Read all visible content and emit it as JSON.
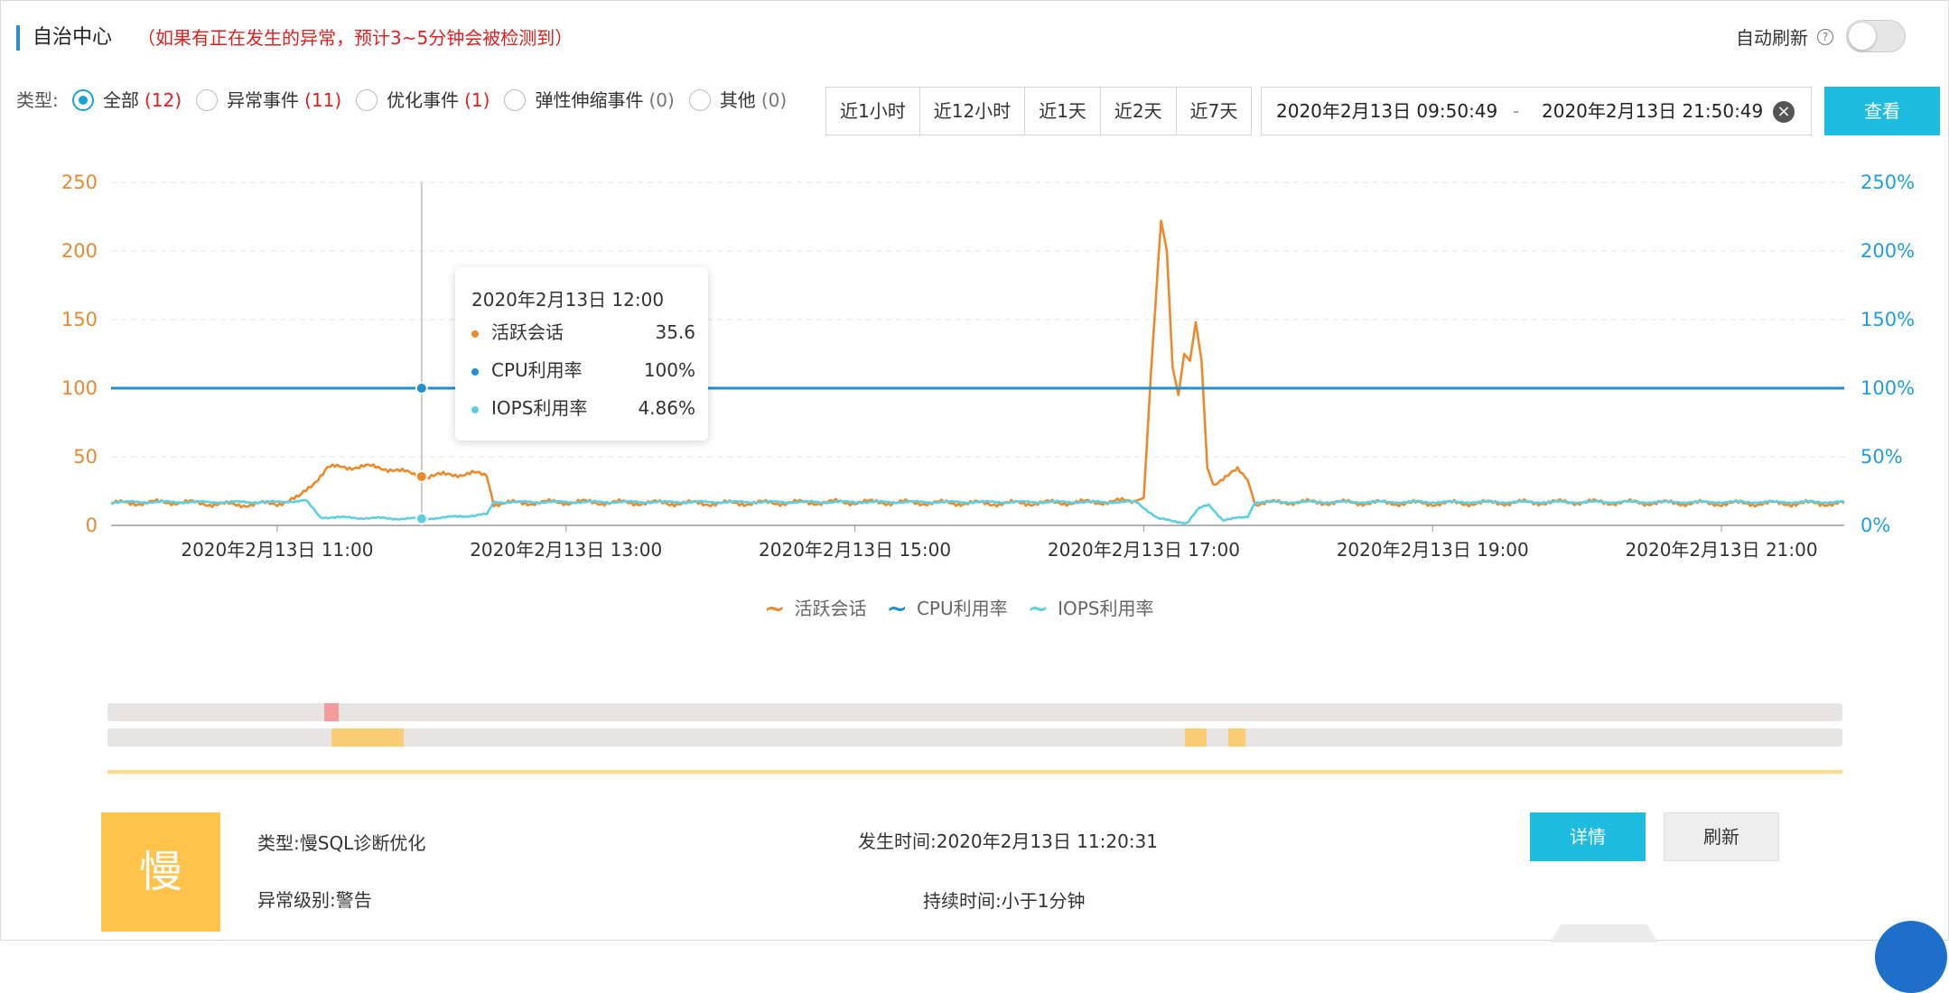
{
  "header": {
    "title": "自治中心",
    "note": "（如果有正在发生的异常，预计3~5分钟会被检测到）",
    "auto_refresh_label": "自动刷新",
    "help_glyph": "?"
  },
  "filter": {
    "type_label": "类型:",
    "options": [
      {
        "label": "全部",
        "count": "(12)",
        "selected": true
      },
      {
        "label": "异常事件",
        "count": "(11)",
        "selected": false
      },
      {
        "label": "优化事件",
        "count": "(1)",
        "selected": false
      },
      {
        "label": "弹性伸缩事件",
        "count": "(0)",
        "selected": false
      },
      {
        "label": "其他",
        "count": "(0)",
        "selected": false
      }
    ],
    "ranges": [
      "近1小时",
      "近12小时",
      "近1天",
      "近2天",
      "近7天"
    ],
    "start": "2020年2月13日 09:50:49",
    "separator": "-",
    "end": "2020年2月13日 21:50:49",
    "clear_glyph": "×",
    "view_button": "查看"
  },
  "chart_data": {
    "type": "line",
    "y_left_ticks": [
      "0",
      "50",
      "100",
      "150",
      "200",
      "250"
    ],
    "y_left_range": [
      0,
      250
    ],
    "y_right_ticks": [
      "0%",
      "50%",
      "100%",
      "150%",
      "200%",
      "250%"
    ],
    "y_right_range": [
      0,
      250
    ],
    "x_tick_labels": [
      "2020年2月13日 11:00",
      "2020年2月13日 13:00",
      "2020年2月13日 15:00",
      "2020年2月13日 17:00",
      "2020年2月13日 19:00",
      "2020年2月13日 21:00"
    ],
    "x_range_hours": [
      9.85,
      21.85
    ],
    "x_unit": "hour of 2020年2月13日",
    "series": [
      {
        "name": "活跃会话",
        "axis": "left",
        "color": "#ec8a2b",
        "points": [
          [
            9.85,
            16
          ],
          [
            10.3,
            17
          ],
          [
            10.7,
            15
          ],
          [
            11.0,
            16
          ],
          [
            11.15,
            20
          ],
          [
            11.35,
            42
          ],
          [
            11.6,
            43
          ],
          [
            11.8,
            41
          ],
          [
            12.0,
            35.6
          ],
          [
            12.2,
            37
          ],
          [
            12.35,
            38
          ],
          [
            12.45,
            36
          ],
          [
            12.5,
            16
          ],
          [
            13.0,
            17
          ],
          [
            14.0,
            16
          ],
          [
            15.0,
            17
          ],
          [
            16.0,
            16
          ],
          [
            16.7,
            17
          ],
          [
            16.95,
            18
          ],
          [
            17.0,
            20
          ],
          [
            17.05,
            110
          ],
          [
            17.12,
            222
          ],
          [
            17.16,
            200
          ],
          [
            17.2,
            115
          ],
          [
            17.24,
            95
          ],
          [
            17.28,
            125
          ],
          [
            17.32,
            120
          ],
          [
            17.36,
            148
          ],
          [
            17.4,
            120
          ],
          [
            17.44,
            42
          ],
          [
            17.48,
            30
          ],
          [
            17.55,
            35
          ],
          [
            17.65,
            40
          ],
          [
            17.72,
            33
          ],
          [
            17.77,
            16
          ],
          [
            18.0,
            17
          ],
          [
            19.0,
            16
          ],
          [
            20.0,
            17
          ],
          [
            21.0,
            16
          ],
          [
            21.85,
            16
          ]
        ]
      },
      {
        "name": "CPU利用率",
        "axis": "right",
        "color": "#1e8fd8",
        "points": [
          [
            9.85,
            100
          ],
          [
            21.85,
            100
          ]
        ]
      },
      {
        "name": "IOPS利用率",
        "axis": "right",
        "color": "#5cd0e2",
        "points": [
          [
            9.85,
            17
          ],
          [
            11.0,
            17
          ],
          [
            11.2,
            18
          ],
          [
            11.3,
            6
          ],
          [
            11.8,
            5
          ],
          [
            12.0,
            4.86
          ],
          [
            12.2,
            6
          ],
          [
            12.45,
            8
          ],
          [
            12.5,
            17
          ],
          [
            16.7,
            17
          ],
          [
            16.95,
            17
          ],
          [
            17.1,
            5
          ],
          [
            17.2,
            3
          ],
          [
            17.3,
            2
          ],
          [
            17.38,
            12
          ],
          [
            17.45,
            15
          ],
          [
            17.55,
            4
          ],
          [
            17.72,
            6
          ],
          [
            17.77,
            17
          ],
          [
            21.85,
            17
          ]
        ]
      }
    ],
    "cursor_x": 12.0
  },
  "tooltip": {
    "title": "2020年2月13日 12:00",
    "rows": [
      {
        "name": "活跃会话",
        "value": "35.6",
        "color": "#ec8a2b"
      },
      {
        "name": "CPU利用率",
        "value": "100%",
        "color": "#1e8fd8"
      },
      {
        "name": "IOPS利用率",
        "value": "4.86%",
        "color": "#5cd0e2"
      }
    ]
  },
  "legend": [
    {
      "name": "活跃会话",
      "color": "#ec8a2b",
      "glyph": "~"
    },
    {
      "name": "CPU利用率",
      "color": "#1e8fd8",
      "glyph": "~"
    },
    {
      "name": "IOPS利用率",
      "color": "#5cd0e2",
      "glyph": "~"
    }
  ],
  "timeline": {
    "rows": [
      {
        "marks": [
          {
            "start": 11.35,
            "end": 11.45,
            "color": "#f29c9c"
          }
        ]
      },
      {
        "marks": [
          {
            "start": 11.4,
            "end": 11.9,
            "color": "#fbcd72"
          },
          {
            "start": 17.3,
            "end": 17.45,
            "color": "#fbcd72"
          },
          {
            "start": 17.6,
            "end": 17.72,
            "color": "#fbcd72"
          }
        ]
      }
    ]
  },
  "event": {
    "icon_char": "慢",
    "type_label": "类型:",
    "type_value": "慢SQL诊断优化",
    "level_label": "异常级别:",
    "level_value": "警告",
    "time_label": "发生时间:",
    "time_value": "2020年2月13日 11:20:31",
    "duration_label": "持续时间:",
    "duration_value": "小于1分钟",
    "detail_button": "详情",
    "refresh_button": "刷新"
  },
  "colors": {
    "accent": "#1ebde0",
    "left_axis": "#e8892e",
    "right_axis": "#1e9ee0",
    "alert": "#e02020"
  }
}
